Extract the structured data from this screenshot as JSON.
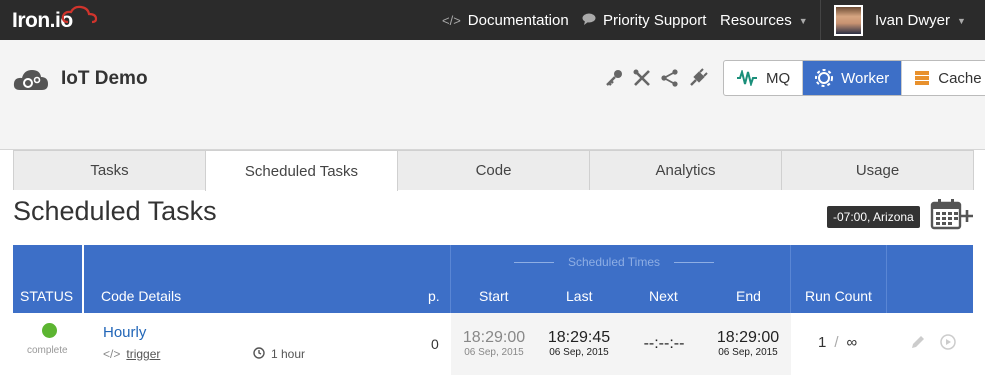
{
  "topbar": {
    "logo": "Iron.io",
    "nav": [
      {
        "label": "Documentation",
        "icon": "code-icon"
      },
      {
        "label": "Priority Support",
        "icon": "chat-bubble-icon"
      },
      {
        "label": "Resources",
        "icon": "chevron-down-icon"
      }
    ],
    "user": {
      "name": "Ivan Dwyer"
    }
  },
  "project": {
    "title": "IoT Demo",
    "services": [
      {
        "label": "MQ",
        "icon": "wave-icon",
        "active": false
      },
      {
        "label": "Worker",
        "icon": "gear-icon",
        "active": true
      },
      {
        "label": "Cache",
        "icon": "stack-icon",
        "active": false
      }
    ]
  },
  "tabs": [
    "Tasks",
    "Scheduled Tasks",
    "Code",
    "Analytics",
    "Usage"
  ],
  "active_tab": "Scheduled Tasks",
  "main": {
    "title": "Scheduled Tasks",
    "timezone": "-07:00, Arizona"
  },
  "table": {
    "headers": {
      "status": "STATUS",
      "code_details": "Code Details",
      "priority": "p.",
      "scheduled_times": "Scheduled   Times",
      "start": "Start",
      "last": "Last",
      "next": "Next",
      "end": "End",
      "run_count": "Run Count"
    },
    "rows": [
      {
        "status": "complete",
        "name": "Hourly",
        "code": "trigger",
        "interval": "1 hour",
        "priority": "0",
        "start_time": "18:29:00",
        "start_date": "06 Sep, 2015",
        "last_time": "18:29:45",
        "last_date": "06 Sep, 2015",
        "next_time": "--:--:--",
        "end_time": "18:29:00",
        "end_date": "06 Sep, 2015",
        "run_count": "1",
        "run_max": "∞"
      }
    ]
  },
  "colors": {
    "accent": "#3d6fc7",
    "topbar": "#2b2b2b",
    "status_complete": "#5cb531",
    "cache": "#e8912d",
    "mq": "#1a8f7a"
  }
}
